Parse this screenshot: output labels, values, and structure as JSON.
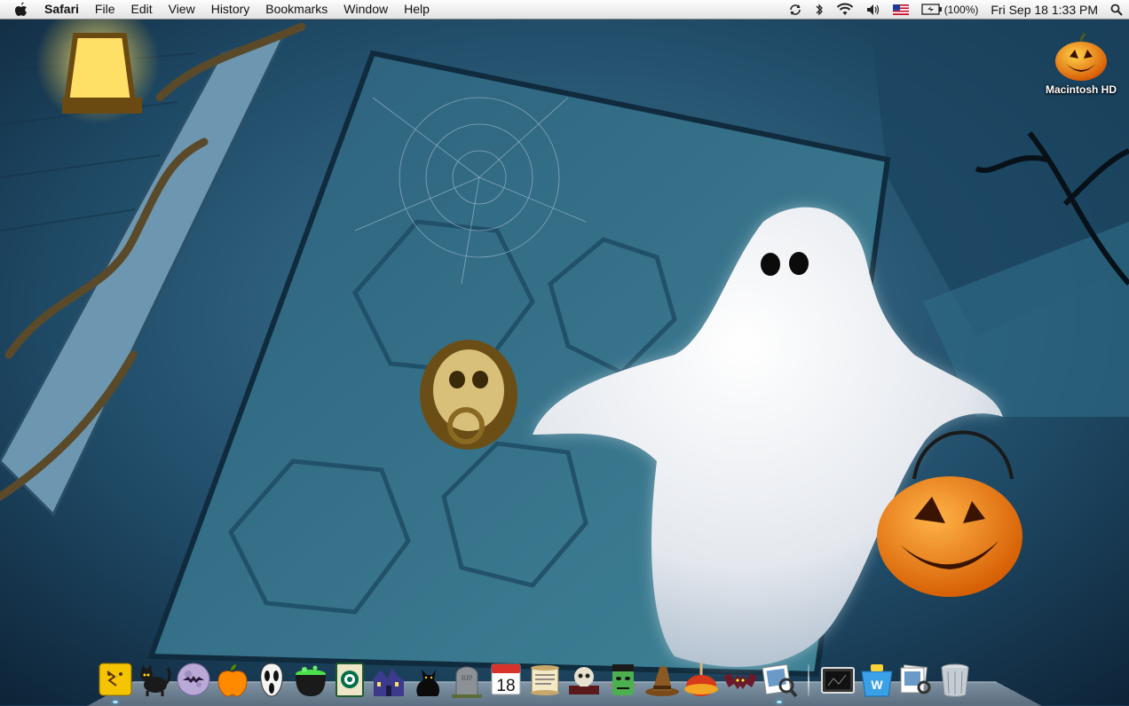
{
  "menubar": {
    "apple_icon": "apple-icon",
    "app_name": "Safari",
    "menus": [
      "File",
      "Edit",
      "View",
      "History",
      "Bookmarks",
      "Window",
      "Help"
    ],
    "status": {
      "sync_icon": "sync-icon",
      "bluetooth_icon": "bluetooth-icon",
      "wifi_icon": "wifi-icon",
      "volume_icon": "volume-icon",
      "flag_icon": "us-flag-icon",
      "battery_icon": "battery-icon",
      "battery_percent": "(100%)",
      "clock": "Fri Sep 18  1:33 PM",
      "spotlight_icon": "spotlight-search-icon"
    }
  },
  "desktop": {
    "icons": [
      {
        "label": "Macintosh HD",
        "icon": "pumpkin-drive-icon"
      }
    ]
  },
  "dock": {
    "apps": [
      {
        "name": "Finder",
        "icon": "finder-icon",
        "running": true
      },
      {
        "name": "Black Cat",
        "icon": "black-cat-icon",
        "running": false
      },
      {
        "name": "Moon",
        "icon": "moon-bat-icon",
        "running": false
      },
      {
        "name": "Apple",
        "icon": "orange-apple-icon",
        "running": false
      },
      {
        "name": "Scream Mask",
        "icon": "scream-mask-icon",
        "running": false
      },
      {
        "name": "Cauldron",
        "icon": "cauldron-icon",
        "running": false
      },
      {
        "name": "Starbucks Book",
        "icon": "starbucks-book-icon",
        "running": false
      },
      {
        "name": "Haunted House",
        "icon": "haunted-house-icon",
        "running": false
      },
      {
        "name": "Cat Silhouette",
        "icon": "cat-silhouette-icon",
        "running": false
      },
      {
        "name": "Tombstone",
        "icon": "tombstone-icon",
        "running": false
      },
      {
        "name": "iCal",
        "icon": "calendar-icon",
        "running": false,
        "date": "18"
      },
      {
        "name": "Scroll",
        "icon": "scroll-icon",
        "running": false
      },
      {
        "name": "Skull Book",
        "icon": "skull-book-icon",
        "running": false
      },
      {
        "name": "Frankenstein",
        "icon": "frankenstein-icon",
        "running": false
      },
      {
        "name": "Witch Hat",
        "icon": "witch-hat-icon",
        "running": false
      },
      {
        "name": "Candy Apple",
        "icon": "candy-apple-icon",
        "running": false
      },
      {
        "name": "Bat",
        "icon": "bat-icon",
        "running": false
      },
      {
        "name": "Preview",
        "icon": "preview-icon",
        "running": true
      }
    ],
    "others": [
      {
        "name": "Screen",
        "icon": "screen-folder-icon"
      },
      {
        "name": "Bucket",
        "icon": "bucket-folder-icon"
      },
      {
        "name": "Preview Stack",
        "icon": "preview-stack-icon"
      },
      {
        "name": "Trash",
        "icon": "trash-icon"
      }
    ]
  }
}
